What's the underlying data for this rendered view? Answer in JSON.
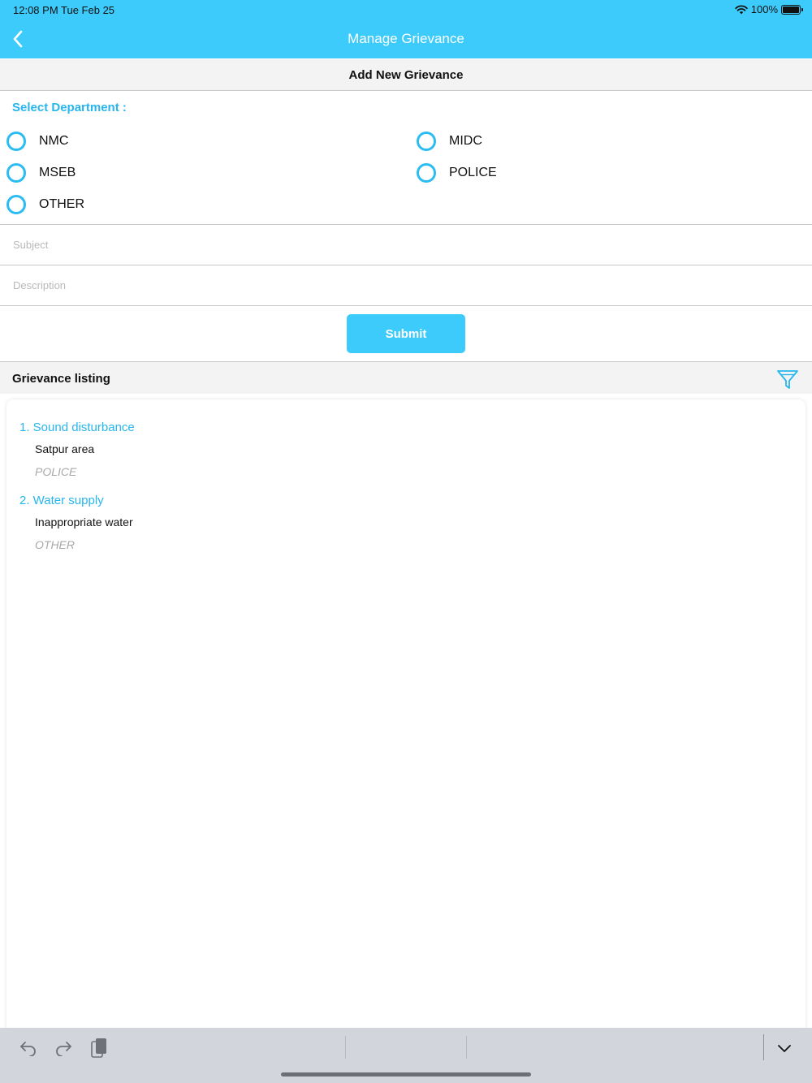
{
  "status": {
    "time": "12:08 PM   Tue Feb 25",
    "battery": "100%"
  },
  "nav": {
    "title": "Manage Grievance",
    "back_icon": "chevron-left-icon"
  },
  "form": {
    "header": "Add New Grievance",
    "department_label": "Select Department :",
    "departments": [
      "NMC",
      "MIDC",
      "MSEB",
      "POLICE",
      "OTHER"
    ],
    "subject_placeholder": "Subject",
    "description_placeholder": "Description",
    "submit_label": "Submit"
  },
  "listing": {
    "title": "Grievance listing",
    "filter_icon": "filter-icon",
    "items": [
      {
        "title": "1. Sound disturbance",
        "description": "Satpur area",
        "department": "POLICE"
      },
      {
        "title": "2. Water supply",
        "description": "Inappropriate water",
        "department": "OTHER"
      }
    ]
  },
  "keyboard_bar": {
    "icons": [
      "undo-icon",
      "redo-icon",
      "paste-icon",
      "chevron-down-icon"
    ]
  },
  "colors": {
    "accent": "#3ccbfb",
    "accent_text": "#27b6ee"
  }
}
